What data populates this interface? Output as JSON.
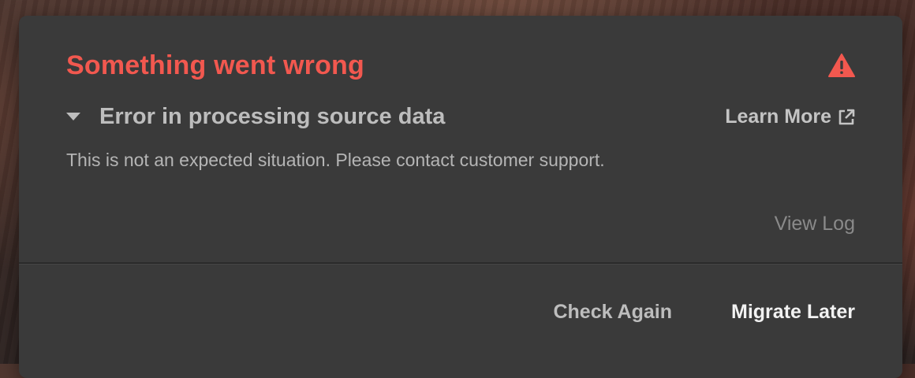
{
  "dialog": {
    "title": "Something went wrong",
    "icon": "warning-icon",
    "error_heading": "Error in processing source data",
    "learn_more_label": "Learn More",
    "message": "This is not an expected situation. Please contact customer support.",
    "view_log_label": "View Log",
    "buttons": {
      "check_again": "Check Again",
      "migrate_later": "Migrate Later"
    }
  },
  "colors": {
    "title": "#f2584f",
    "dialog_background": "#3a3a3a",
    "muted_text": "#bdbdbd",
    "primary_button_text": "#f2f2f2"
  }
}
